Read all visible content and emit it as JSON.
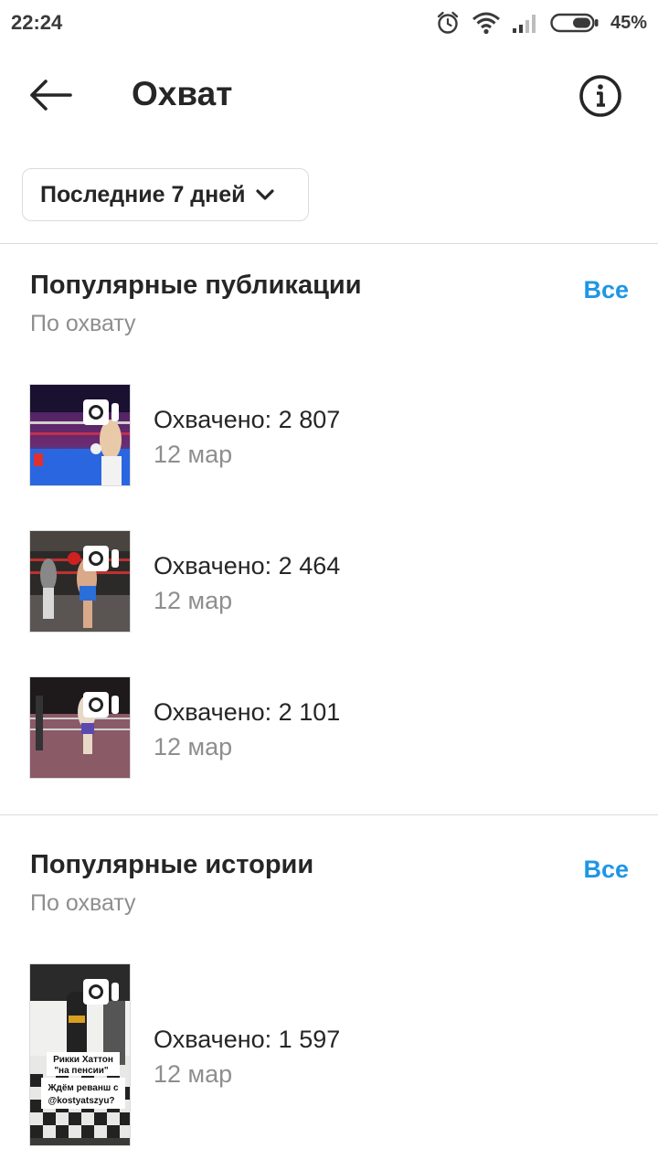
{
  "status_bar": {
    "time": "22:24",
    "battery": "45%",
    "icons": [
      "alarm-icon",
      "wifi-icon",
      "signal-icon",
      "battery-icon"
    ]
  },
  "header": {
    "title": "Охват",
    "back_icon": "back-arrow-icon",
    "info_icon": "info-icon"
  },
  "filter": {
    "label": "Последние 7 дней",
    "icon": "chevron-down-icon"
  },
  "top_posts": {
    "title": "Популярные публикации",
    "subtitle": "По охвату",
    "see_all": "Все",
    "items": [
      {
        "reach": "Охвачено: 2 807",
        "date": "12 мар"
      },
      {
        "reach": "Охвачено: 2 464",
        "date": "12 мар"
      },
      {
        "reach": "Охвачено: 2 101",
        "date": "12 мар"
      }
    ]
  },
  "top_stories": {
    "title": "Популярные истории",
    "subtitle": "По охвату",
    "see_all": "Все",
    "items": [
      {
        "reach": "Охвачено: 1 597",
        "date": "12 мар",
        "caption_line1": "Рикки Хаттон",
        "caption_line2": "\"на пенсии\"",
        "caption_line3": "Ждём реванш с",
        "caption_line4": "@kostyatszyu?"
      }
    ]
  },
  "colors": {
    "accent": "#1e96e6",
    "text_primary": "#262626",
    "text_secondary": "#8e8e8e",
    "divider": "#dbdbdb"
  }
}
